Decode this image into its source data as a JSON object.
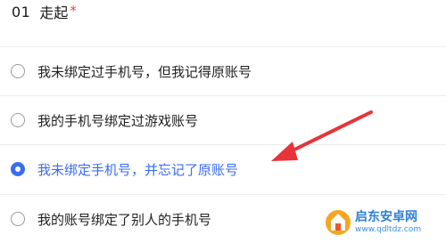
{
  "question": {
    "number": "01",
    "title": "走起",
    "required_mark": "*"
  },
  "options": [
    {
      "label": "我未绑定过手机号，但我记得原账号",
      "checked": false
    },
    {
      "label": "我的手机号绑定过游戏账号",
      "checked": false
    },
    {
      "label": "我未绑定手机号，并忘记了原账号",
      "checked": true
    },
    {
      "label": "我的账号绑定了别人的手机号",
      "checked": false
    }
  ],
  "colors": {
    "accent": "#3a6cf0",
    "required": "#e54646",
    "arrow": "#e8333a"
  },
  "watermark": {
    "name": "启东安卓网",
    "url": "www.qdltdz.com"
  }
}
